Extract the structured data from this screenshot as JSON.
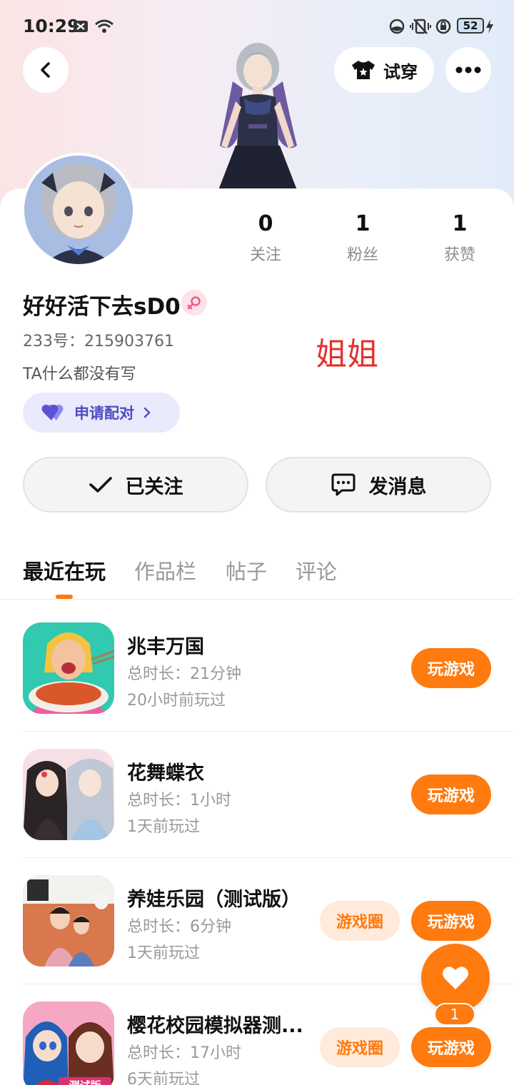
{
  "status_bar": {
    "time": "10:29",
    "battery": "52"
  },
  "header": {
    "try_on_label": "试穿"
  },
  "profile": {
    "stats": [
      {
        "value": "0",
        "label": "关注"
      },
      {
        "value": "1",
        "label": "粉丝"
      },
      {
        "value": "1",
        "label": "获赞"
      }
    ],
    "username": "好好活下去sD0",
    "uid": "233号：215903761",
    "bio": "TA什么都没有写",
    "overlay_text": "姐姐",
    "pair_label": "申请配对",
    "followed_label": "已关注",
    "message_label": "发消息"
  },
  "tabs": [
    "最近在玩",
    "作品栏",
    "帖子",
    "评论"
  ],
  "games": [
    {
      "title": "兆丰万国",
      "duration": "总时长：21分钟",
      "last_played": "20小时前玩过",
      "play_label": "玩游戏"
    },
    {
      "title": "花舞蝶衣",
      "duration": "总时长：1小时",
      "last_played": "1天前玩过",
      "play_label": "玩游戏"
    },
    {
      "title": "养娃乐园（测试版）",
      "duration": "总时长：6分钟",
      "last_played": "1天前玩过",
      "circle_label": "游戏圈",
      "play_label": "玩游戏"
    },
    {
      "title": "樱花校园模拟器测...",
      "duration": "总时长：17小时",
      "last_played": "6天前玩过",
      "circle_label": "游戏圈",
      "play_label": "玩游戏",
      "icon_tag": "测试版"
    }
  ],
  "like_fab": {
    "count": "1"
  },
  "colors": {
    "accent": "#ff7a0f",
    "pair_purple": "#4d4bc4",
    "overlay_red": "#e0342f"
  }
}
